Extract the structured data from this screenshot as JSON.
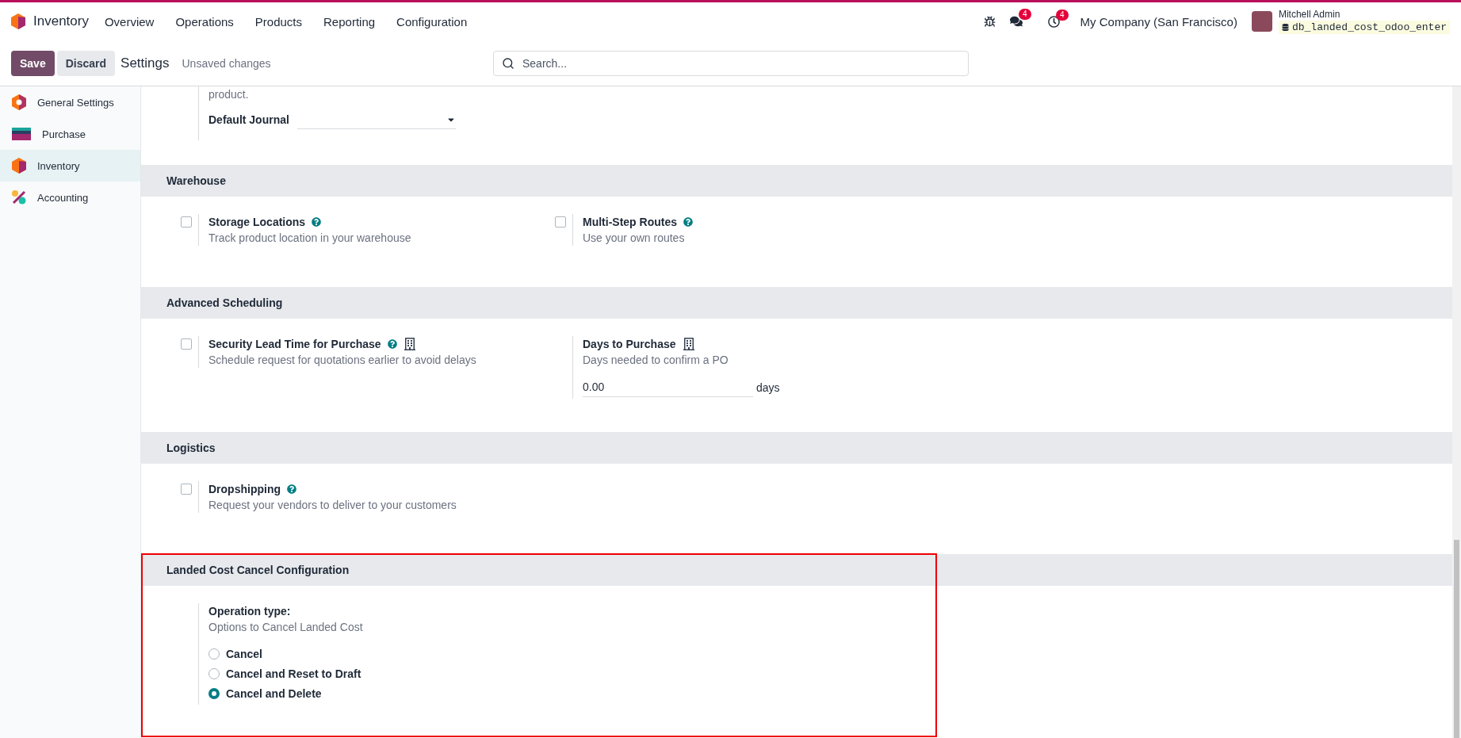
{
  "navbar": {
    "app_name": "Inventory",
    "menu": [
      "Overview",
      "Operations",
      "Products",
      "Reporting",
      "Configuration"
    ],
    "messages_count": "4",
    "activities_count": "4",
    "company": "My Company (San Francisco)",
    "user_name": "Mitchell Admin",
    "database": "db_landed_cost_odoo_enter"
  },
  "control_panel": {
    "save_label": "Save",
    "discard_label": "Discard",
    "title": "Settings",
    "status": "Unsaved changes",
    "search": {
      "placeholder": "Search..."
    }
  },
  "sidebar": {
    "items": [
      {
        "label": "General Settings",
        "selected": false
      },
      {
        "label": "Purchase",
        "selected": false
      },
      {
        "label": "Inventory",
        "selected": true
      },
      {
        "label": "Accounting",
        "selected": false
      }
    ]
  },
  "top_fragment": {
    "text": "product.",
    "field_label": "Default Journal"
  },
  "sections": [
    {
      "title": "Warehouse",
      "settings": [
        {
          "kind": "checkbox",
          "title": "Storage Locations",
          "description": "Track product location in your warehouse",
          "checked": false,
          "help": true,
          "company_specific": false
        },
        {
          "kind": "checkbox",
          "title": "Multi-Step Routes",
          "description": "Use your own routes",
          "checked": false,
          "help": true,
          "company_specific": false
        }
      ]
    },
    {
      "title": "Advanced Scheduling",
      "settings": [
        {
          "kind": "checkbox",
          "title": "Security Lead Time for Purchase",
          "description": "Schedule request for quotations earlier to avoid delays",
          "checked": false,
          "help": true,
          "company_specific": true
        },
        {
          "kind": "number",
          "title": "Days to Purchase",
          "description": "Days needed to confirm a PO",
          "value": "0.00",
          "unit": "days",
          "help": false,
          "company_specific": true
        }
      ]
    },
    {
      "title": "Logistics",
      "settings": [
        {
          "kind": "checkbox",
          "title": "Dropshipping",
          "description": "Request your vendors to deliver to your customers",
          "checked": false,
          "help": true,
          "company_specific": false
        }
      ]
    },
    {
      "title": "Landed Cost Cancel Configuration",
      "highlighted": true,
      "settings": [
        {
          "kind": "radio",
          "title": "Operation type:",
          "description": "Options to Cancel Landed Cost",
          "options": [
            {
              "label": "Cancel",
              "selected": false
            },
            {
              "label": "Cancel and Reset to Draft",
              "selected": false
            },
            {
              "label": "Cancel and Delete",
              "selected": true
            }
          ]
        }
      ]
    }
  ]
}
